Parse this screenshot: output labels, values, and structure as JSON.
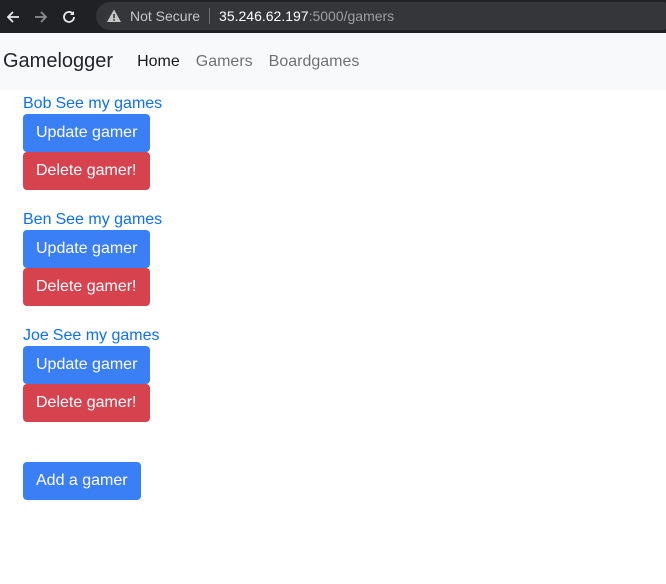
{
  "browser": {
    "security_label": "Not Secure",
    "url_host": "35.246.62.197",
    "url_path": ":5000/gamers"
  },
  "navbar": {
    "brand": "Gamelogger",
    "links": [
      "Home",
      "Gamers",
      "Boardgames"
    ]
  },
  "gamers": [
    {
      "name": "Bob",
      "link_text": "See my games",
      "update_label": "Update gamer",
      "delete_label": "Delete gamer!"
    },
    {
      "name": "Ben",
      "link_text": "See my games",
      "update_label": "Update gamer",
      "delete_label": "Delete gamer!"
    },
    {
      "name": "Joe",
      "link_text": "See my games",
      "update_label": "Update gamer",
      "delete_label": "Delete gamer!"
    }
  ],
  "add_button_label": "Add a gamer",
  "colors": {
    "primary": "#3a7ff6",
    "danger": "#d6424e",
    "link": "#0d6efd",
    "navbar_bg": "#f8f9fa"
  }
}
